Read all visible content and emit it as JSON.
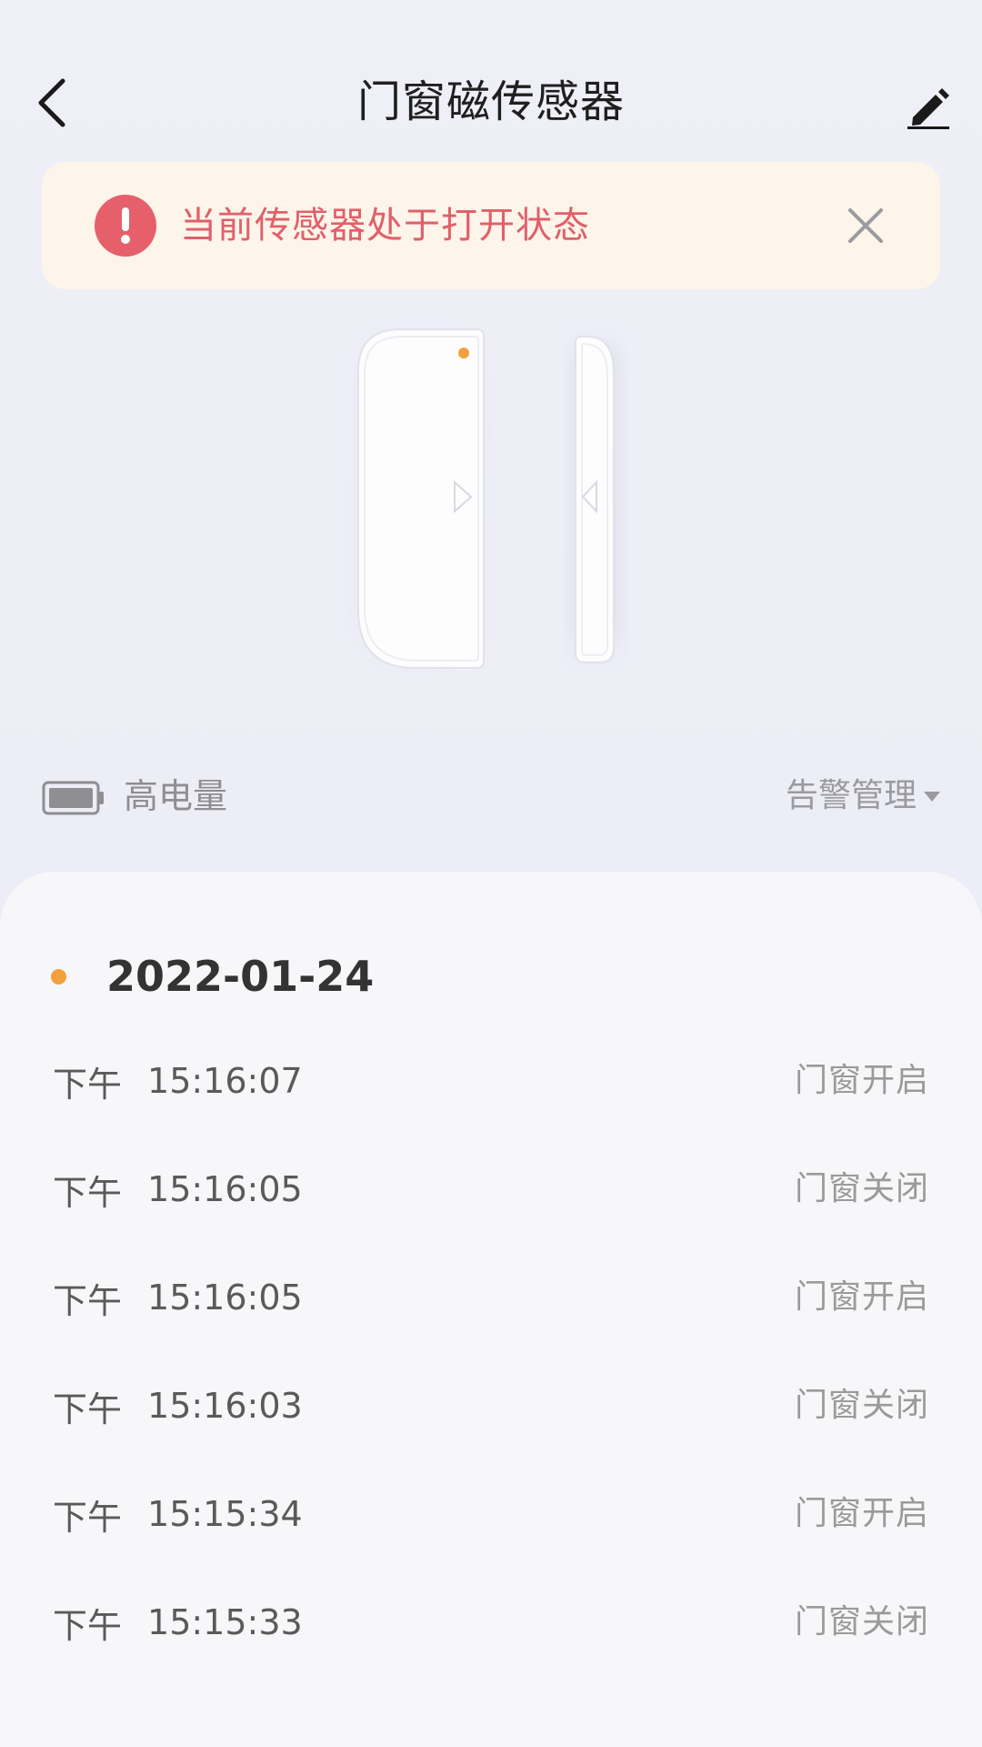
{
  "header": {
    "title": "门窗磁传感器",
    "back_icon": "chevron-left-icon",
    "edit_icon": "pencil-icon"
  },
  "alert": {
    "text": "当前传感器处于打开状态",
    "icon": "exclamation-circle-icon",
    "close_icon": "close-icon",
    "color": "#e0606a",
    "background": "#fdf4ea"
  },
  "device": {
    "image": "door-window-sensor-illustration",
    "indicator_color": "#f3a03c"
  },
  "status": {
    "battery_label": "高电量",
    "battery_icon": "battery-full-icon",
    "alarm_management": "告警管理",
    "alarm_caret": "caret-down-icon"
  },
  "log": {
    "date": "2022-01-24",
    "date_dot_color": "#f3a03c",
    "entries": [
      {
        "period": "下午",
        "time": "15:16:07",
        "state": "门窗开启"
      },
      {
        "period": "下午",
        "time": "15:16:05",
        "state": "门窗关闭"
      },
      {
        "period": "下午",
        "time": "15:16:05",
        "state": "门窗开启"
      },
      {
        "period": "下午",
        "time": "15:16:03",
        "state": "门窗关闭"
      },
      {
        "period": "下午",
        "time": "15:15:34",
        "state": "门窗开启"
      },
      {
        "period": "下午",
        "time": "15:15:33",
        "state": "门窗关闭"
      }
    ]
  }
}
